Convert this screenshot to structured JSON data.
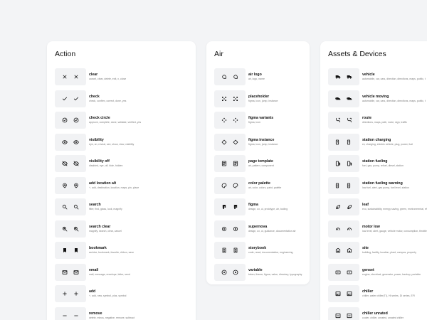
{
  "colors": {
    "background": "#f3f4f6",
    "card": "#ffffff",
    "tile": "#f1f2f4",
    "icon": "#111111"
  },
  "cards": [
    {
      "title": "Action",
      "items": [
        {
          "name": "clear",
          "tags": "cancel, clear, delete, exit, x, close",
          "icon": "x-icon"
        },
        {
          "name": "check",
          "tags": "check, confirm, correct, done, yes",
          "icon": "check-icon"
        },
        {
          "name": "check circle",
          "tags": "approve, complete, done, validate, verified, yes",
          "icon": "check-circle-icon"
        },
        {
          "name": "visibility",
          "tags": "eye, on, reveal, see, show, view, visibility",
          "icon": "eye-icon"
        },
        {
          "name": "visibility off",
          "tags": "disabled, eye, off, hide, hidden",
          "icon": "eye-off-icon"
        },
        {
          "name": "add location alt",
          "tags": "+, add, destination, location, maps, pin, place",
          "icon": "add-location-icon"
        },
        {
          "name": "search",
          "tags": "filter, find, glass, look, magnify",
          "icon": "search-icon"
        },
        {
          "name": "search clear",
          "tags": "magnify, search, clear, cancel",
          "icon": "search-clear-icon"
        },
        {
          "name": "bookmark",
          "tags": "archive, bookmark, favorite, ribbon, save",
          "icon": "bookmark-icon"
        },
        {
          "name": "email",
          "tags": "mail, message, envelope, letter, send",
          "icon": "email-icon"
        },
        {
          "name": "add",
          "tags": "+, add, new, symbol, plus, symbol",
          "icon": "add-icon"
        },
        {
          "name": "remove",
          "tags": "delete, minus, negative, remove, subtract",
          "icon": "remove-icon"
        }
      ]
    },
    {
      "title": "Air",
      "items": [
        {
          "name": "air logo",
          "tags": "air, logo, name",
          "icon": "air-logo-icon"
        },
        {
          "name": "placeholder",
          "tags": "figma, icon, jump, instance",
          "icon": "placeholder-icon"
        },
        {
          "name": "figma variants",
          "tags": "figma, icon",
          "icon": "figma-variants-icon"
        },
        {
          "name": "figma instance",
          "tags": "figma, icon, jump, instance",
          "icon": "figma-instance-icon"
        },
        {
          "name": "page template",
          "tags": "air, pattern, component",
          "icon": "page-template-icon"
        },
        {
          "name": "color palette",
          "tags": "air, color, colors, paint, palette",
          "icon": "color-palette-icon"
        },
        {
          "name": "figma",
          "tags": "design, ux, ui, prototype, air, tooling",
          "icon": "figma-icon"
        },
        {
          "name": "supernova",
          "tags": "design, ux, ui, guidance, documentation air",
          "icon": "supernova-icon"
        },
        {
          "name": "storybook",
          "tags": "code, react, documentation, engineering",
          "icon": "storybook-icon"
        },
        {
          "name": "variable",
          "tags": "token, theme, figma, value, directory, typography",
          "icon": "variable-icon"
        }
      ]
    },
    {
      "title": "Assets & Devices",
      "items": [
        {
          "name": "vehicle",
          "tags": "automobile, car, cars, direction, directions, maps, public, t",
          "icon": "vehicle-icon"
        },
        {
          "name": "vehicle moving",
          "tags": "automobile, car, cars, direction, directions, maps, public, t",
          "icon": "vehicle-moving-icon"
        },
        {
          "name": "route",
          "tags": "directions, maps, path, route, sign, traffic",
          "icon": "route-icon"
        },
        {
          "name": "station charging",
          "tags": "ev, charging, electric vehicle, plug, power, fuel",
          "icon": "station-charging-icon"
        },
        {
          "name": "station fueling",
          "tags": "fuel, gas, pump, refuel, diesel, station",
          "icon": "station-fueling-icon"
        },
        {
          "name": "station fueling warning",
          "tags": "low fuel, alert, gas pump, fuel level, station",
          "icon": "station-fueling-warning-icon"
        },
        {
          "name": "leaf",
          "tags": "eco, sustainability, energy saving, green, environmental, eff",
          "icon": "leaf-icon"
        },
        {
          "name": "motor low",
          "tags": "low level, alert, gauge, vehicle motor, consumption, throttle",
          "icon": "motor-low-icon"
        },
        {
          "name": "site",
          "tags": "building, facility, location, plant, campus, property",
          "icon": "site-icon"
        },
        {
          "name": "genset",
          "tags": "engine, electrical, generator, power, backup, portable",
          "icon": "genset-icon"
        },
        {
          "name": "chiller",
          "tags": "chiller, water chiller(TI), HI series, DI series, EFI",
          "icon": "chiller-icon"
        },
        {
          "name": "chiller unrated",
          "tags": "cooler, chiller, unrated, unrated chiller",
          "icon": "chiller-unrated-icon"
        }
      ]
    }
  ]
}
